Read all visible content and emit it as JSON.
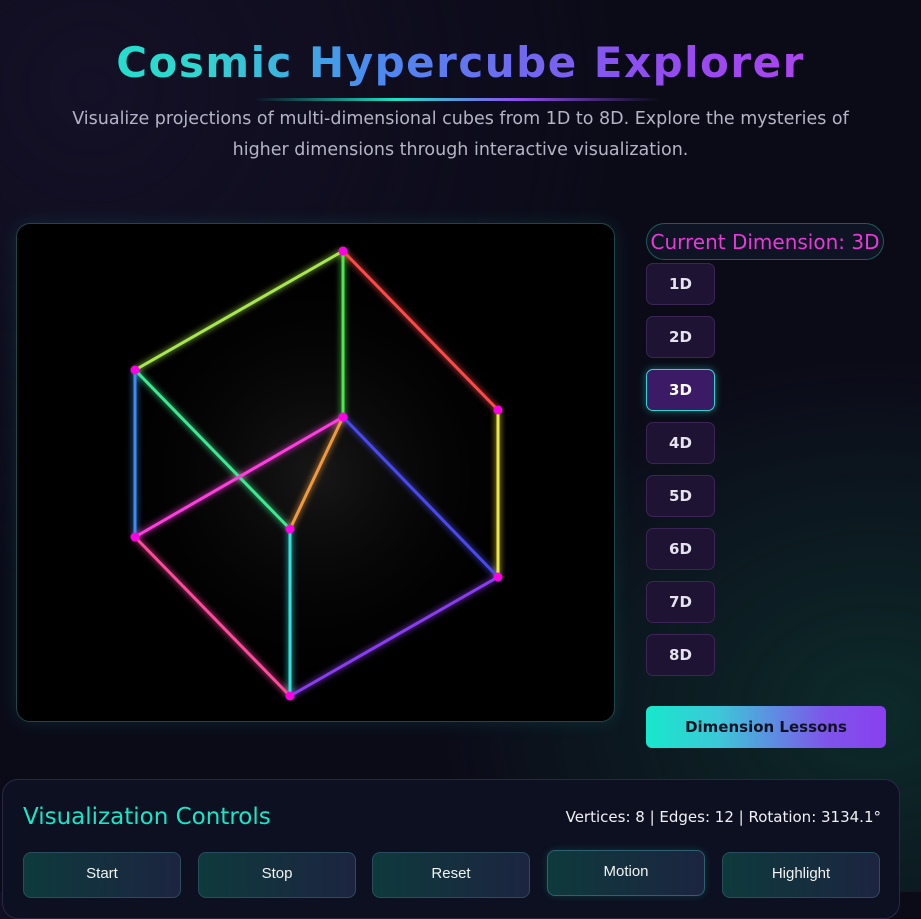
{
  "header": {
    "title": "Cosmic Hypercube Explorer",
    "subtitle": "Visualize projections of multi-dimensional cubes from 1D to 8D. Explore the mysteries of higher dimensions through interactive visualization."
  },
  "sidebar": {
    "current_dimension": "Current Dimension: 3D",
    "dimensions": [
      {
        "label": "1D",
        "active": false
      },
      {
        "label": "2D",
        "active": false
      },
      {
        "label": "3D",
        "active": true
      },
      {
        "label": "4D",
        "active": false
      },
      {
        "label": "5D",
        "active": false
      },
      {
        "label": "6D",
        "active": false
      },
      {
        "label": "7D",
        "active": false
      },
      {
        "label": "8D",
        "active": false
      }
    ],
    "lessons_button": "Dimension Lessons"
  },
  "controls": {
    "title": "Visualization Controls",
    "stats": "Vertices: 8 | Edges: 12 | Rotation: 3134.1°",
    "buttons": [
      "Start",
      "Stop",
      "Reset",
      "Motion",
      "Highlight"
    ]
  },
  "colors": {
    "accent_teal": "#17e6c8",
    "accent_purple": "#8f4df0",
    "accent_magenta": "#e83ad8",
    "vertex": "#ff00e6"
  },
  "cube": {
    "edge_colors": [
      "#a8e84a",
      "#ff4a4a",
      "#4de84a",
      "#3c8cf0",
      "#3ce890",
      "#f0e63c",
      "#ff3ce0",
      "#f09a3c",
      "#4a4af0",
      "#ff4a9a",
      "#30e0e0",
      "#8a3cf0"
    ]
  }
}
